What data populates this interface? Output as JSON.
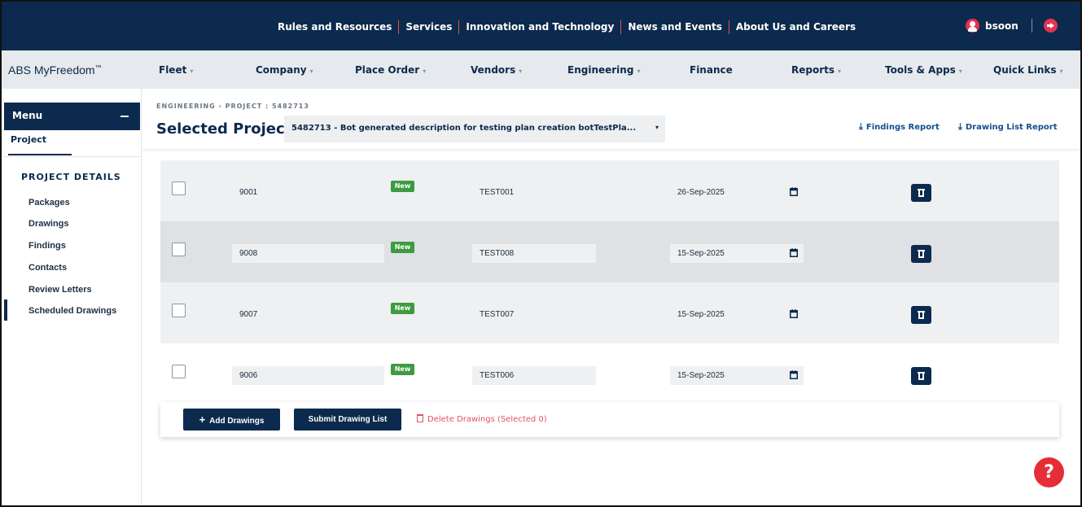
{
  "top_nav": {
    "items": [
      "Rules and Resources",
      "Services",
      "Innovation and Technology",
      "News and Events",
      "About Us and Careers"
    ],
    "user_name": "bsoon"
  },
  "brand": {
    "name": "ABS MyFreedom",
    "mark": "™"
  },
  "main_menu": [
    {
      "label": "Fleet",
      "caret": "▾"
    },
    {
      "label": "Company",
      "caret": "▾"
    },
    {
      "label": "Place Order",
      "caret": "▾"
    },
    {
      "label": "Vendors",
      "caret": "▾"
    },
    {
      "label": "Engineering",
      "caret": "▾"
    },
    {
      "label": "Finance",
      "caret": ""
    },
    {
      "label": "Reports",
      "caret": "▾"
    },
    {
      "label": "Tools & Apps",
      "caret": "▾"
    },
    {
      "label": "Quick Links",
      "caret": "▾"
    }
  ],
  "sidebar": {
    "menu_label": "Menu",
    "tab_label": "Project",
    "section_title": "PROJECT DETAILS",
    "links": [
      "Packages",
      "Drawings",
      "Findings",
      "Contacts",
      "Review Letters",
      "Scheduled Drawings"
    ],
    "active_link": "Scheduled Drawings"
  },
  "header": {
    "breadcrumb": "ENGINEERING  ›  PROJECT : 5482713",
    "selected_label": "Selected Project:",
    "selected_value": "5482713 - Bot generated description for testing plan creation botTestPla...",
    "caret": "▾",
    "findings_report": "Findings Report",
    "drawing_list_report": "Drawing List Report"
  },
  "rows": [
    {
      "number": "9001",
      "badge": "New",
      "code": "TEST001",
      "date": "26-Sep-2025"
    },
    {
      "number": "9008",
      "badge": "New",
      "code": "TEST008",
      "date": "15-Sep-2025"
    },
    {
      "number": "9007",
      "badge": "New",
      "code": "TEST007",
      "date": "15-Sep-2025"
    },
    {
      "number": "9006",
      "badge": "New",
      "code": "TEST006",
      "date": "15-Sep-2025"
    }
  ],
  "actions": {
    "add_label": "Add Drawings",
    "submit_label": "Submit Drawing List",
    "delete_label": "Delete Drawings (Selected 0)"
  },
  "help_label": "?",
  "colors": {
    "navy": "#0c2a4d",
    "accent_red": "#e4334f",
    "badge_green": "#3d9b41",
    "delete_red": "#e0535f"
  }
}
